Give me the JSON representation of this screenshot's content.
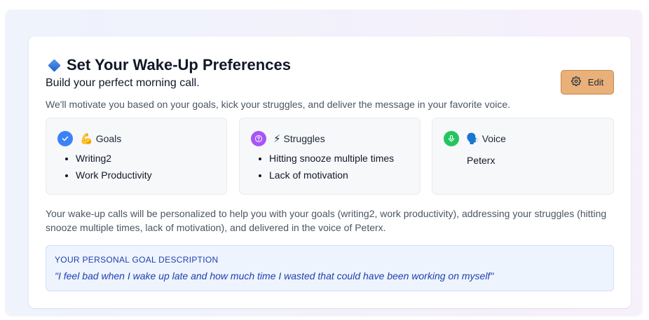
{
  "header": {
    "title": "Set Your Wake-Up Preferences",
    "subtitle": "Build your perfect morning call.",
    "description": "We'll motivate you based on your goals, kick your struggles, and deliver the message in your favorite voice.",
    "edit_label": "Edit"
  },
  "goals": {
    "label": "Goals",
    "emoji": "💪",
    "icon": "check-icon",
    "color": "#3b82f6",
    "items": [
      "Writing2",
      "Work Productivity"
    ]
  },
  "struggles": {
    "label": "Struggles",
    "emoji": "⚡",
    "icon": "question-icon",
    "color": "#a855f7",
    "items": [
      "Hitting snooze multiple times",
      "Lack of motivation"
    ]
  },
  "voice": {
    "label": "Voice",
    "emoji": "🗣️",
    "icon": "microphone-icon",
    "color": "#22c55e",
    "value": "Peterx"
  },
  "summary": "Your wake-up calls will be personalized to help you with your goals (writing2, work productivity), addressing your struggles (hitting snooze multiple times, lack of motivation), and delivered in the voice of Peterx.",
  "goal_description": {
    "heading": "YOUR PERSONAL GOAL DESCRIPTION",
    "text": "\"I feel bad when I wake up late and how much time I wasted that could have been working on myself\""
  },
  "colors": {
    "accent_button": "#eab07a",
    "goal_box_bg": "#eef4fe",
    "goal_text": "#1e40af"
  }
}
